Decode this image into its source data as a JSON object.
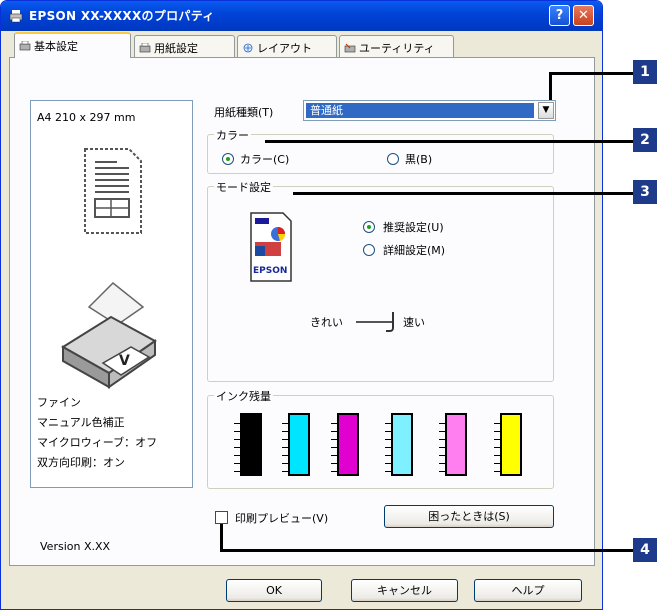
{
  "window": {
    "title": "EPSON XX-XXXXのプロパティ",
    "help_label": "?",
    "close_label": "✕"
  },
  "tabs": [
    {
      "label": "基本設定"
    },
    {
      "label": "用紙設定"
    },
    {
      "label": "レイアウト"
    },
    {
      "label": "ユーティリティ"
    }
  ],
  "preview": {
    "paper_size": "A4 210 x 297 mm",
    "info_lines": [
      "ファイン",
      "マニュアル色補正",
      "マイクロウィーブ：オフ",
      "双方向印刷：オン"
    ]
  },
  "version": "Version X.XX",
  "paper_type": {
    "label": "用紙種類(T)",
    "value": "普通紙"
  },
  "color": {
    "group_label": "カラー",
    "options": [
      "カラー(C)",
      "黒(B)"
    ],
    "selected": "カラー(C)"
  },
  "mode": {
    "group_label": "モード設定",
    "options": [
      "推奨設定(U)",
      "詳細設定(M)"
    ],
    "selected": "推奨設定(U)",
    "icon_text": "EPSON",
    "slider_left": "きれい",
    "slider_right": "速い"
  },
  "ink": {
    "group_label": "インク残量",
    "colors": [
      "#000000",
      "#00e5ff",
      "#e000d0",
      "#7ff0ff",
      "#ff7ff0",
      "#ffff00"
    ]
  },
  "print_preview": {
    "label": "印刷プレビュー(V)",
    "checked": false
  },
  "troubleshoot_button": "困ったときは(S)",
  "footer": {
    "ok": "OK",
    "cancel": "キャンセル",
    "help": "ヘルプ"
  },
  "callouts": [
    "1",
    "2",
    "3",
    "4"
  ],
  "colors": {
    "titlebar": "#0a5bf0",
    "callout": "#1e3a8a",
    "dialog_bg": "#ece9d8"
  }
}
